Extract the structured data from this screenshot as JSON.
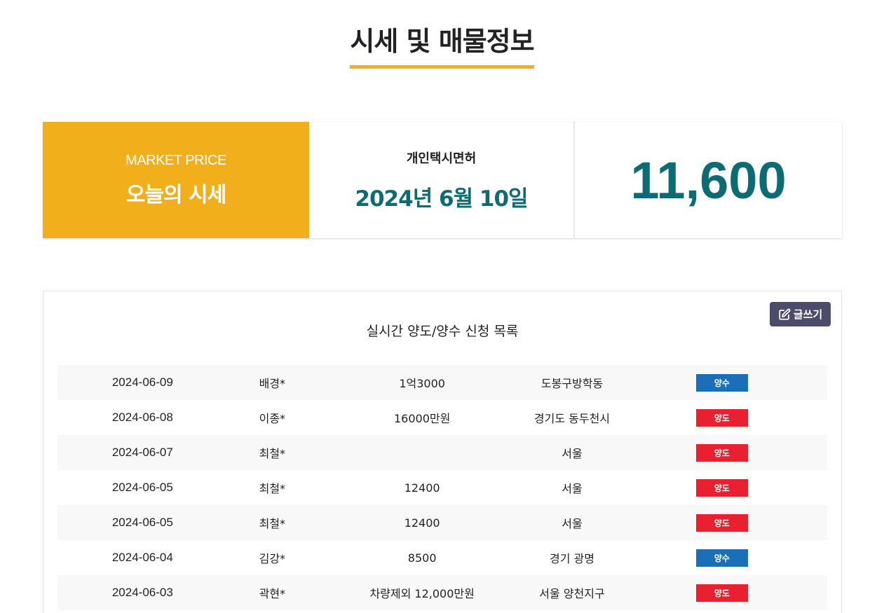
{
  "page": {
    "title": "시세 및 매물정보"
  },
  "market": {
    "label_en": "MARKET PRICE",
    "label_ko": "오늘의 시세",
    "category": "개인택시면허",
    "date": "2024년 6월 10일",
    "price": "11,600"
  },
  "board": {
    "title": "실시간 양도/양수 신청 목록",
    "write_label": "글쓰기",
    "write_icon": "edit-icon",
    "rows": [
      {
        "date": "2024-06-09",
        "name": "배경*",
        "price": "1억3000",
        "area": "도봉구방학동",
        "type": "양수"
      },
      {
        "date": "2024-06-08",
        "name": "이종*",
        "price": "16000만원",
        "area": "경기도 동두천시",
        "type": "양도"
      },
      {
        "date": "2024-06-07",
        "name": "최철*",
        "price": "",
        "area": "서울",
        "type": "양도"
      },
      {
        "date": "2024-06-05",
        "name": "최철*",
        "price": "12400",
        "area": "서울",
        "type": "양도"
      },
      {
        "date": "2024-06-05",
        "name": "최철*",
        "price": "12400",
        "area": "서울",
        "type": "양도"
      },
      {
        "date": "2024-06-04",
        "name": "김강*",
        "price": "8500",
        "area": "경기 광명",
        "type": "양수"
      },
      {
        "date": "2024-06-03",
        "name": "곽현*",
        "price": "차량제외 12,000만원",
        "area": "서울 양천지구",
        "type": "양도"
      }
    ]
  },
  "colors": {
    "accent": "#f2af1c",
    "teal": "#0d6b74",
    "badge_buy": "#1a6fb8",
    "badge_sell": "#e8202f",
    "button": "#4b4b6b"
  }
}
